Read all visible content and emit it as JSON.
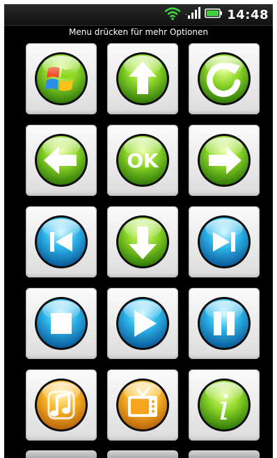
{
  "status_bar": {
    "time": "14:48",
    "icons": [
      "wifi-icon",
      "signal-icon",
      "battery-icon"
    ],
    "accent": "#3fd23f"
  },
  "hint_text": "Menu drücken für mehr Optionen",
  "buttons": [
    {
      "name": "windows-button",
      "icon": "windows-logo-icon",
      "color": "green"
    },
    {
      "name": "up-button",
      "icon": "arrow-up-icon",
      "color": "green"
    },
    {
      "name": "refresh-button",
      "icon": "refresh-icon",
      "color": "green"
    },
    {
      "name": "left-button",
      "icon": "arrow-left-icon",
      "color": "green"
    },
    {
      "name": "ok-button",
      "icon": "ok-icon",
      "color": "green",
      "label": "OK"
    },
    {
      "name": "right-button",
      "icon": "arrow-right-icon",
      "color": "green"
    },
    {
      "name": "previous-button",
      "icon": "skip-back-icon",
      "color": "blue"
    },
    {
      "name": "down-button",
      "icon": "arrow-down-icon",
      "color": "green"
    },
    {
      "name": "next-button",
      "icon": "skip-forward-icon",
      "color": "blue"
    },
    {
      "name": "stop-button",
      "icon": "stop-icon",
      "color": "blue"
    },
    {
      "name": "play-button",
      "icon": "play-icon",
      "color": "blue"
    },
    {
      "name": "pause-button",
      "icon": "pause-icon",
      "color": "blue"
    },
    {
      "name": "music-button",
      "icon": "music-icon",
      "color": "orange"
    },
    {
      "name": "tv-button",
      "icon": "tv-icon",
      "color": "orange"
    },
    {
      "name": "info-button",
      "icon": "info-icon",
      "color": "green",
      "label": "i"
    }
  ],
  "colors": {
    "green_light": "#c8f06a",
    "green_mid": "#6cc61f",
    "green_dark": "#2f7a08",
    "blue_light": "#8ee6ff",
    "blue_mid": "#1aa6e0",
    "blue_dark": "#0a5a99",
    "orange_light": "#ffe07a",
    "orange_mid": "#f6a51a",
    "orange_dark": "#b9640a"
  }
}
